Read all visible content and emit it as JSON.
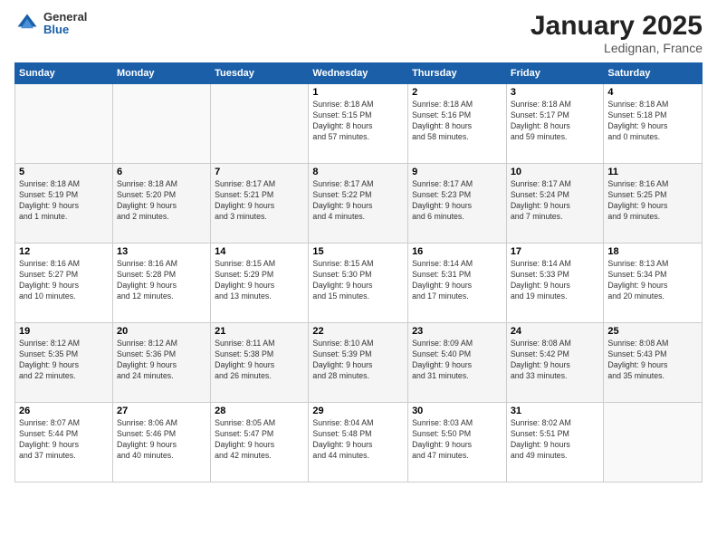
{
  "logo": {
    "general": "General",
    "blue": "Blue"
  },
  "title": "January 2025",
  "location": "Ledignan, France",
  "days_header": [
    "Sunday",
    "Monday",
    "Tuesday",
    "Wednesday",
    "Thursday",
    "Friday",
    "Saturday"
  ],
  "weeks": [
    [
      {
        "num": "",
        "info": ""
      },
      {
        "num": "",
        "info": ""
      },
      {
        "num": "",
        "info": ""
      },
      {
        "num": "1",
        "info": "Sunrise: 8:18 AM\nSunset: 5:15 PM\nDaylight: 8 hours\nand 57 minutes."
      },
      {
        "num": "2",
        "info": "Sunrise: 8:18 AM\nSunset: 5:16 PM\nDaylight: 8 hours\nand 58 minutes."
      },
      {
        "num": "3",
        "info": "Sunrise: 8:18 AM\nSunset: 5:17 PM\nDaylight: 8 hours\nand 59 minutes."
      },
      {
        "num": "4",
        "info": "Sunrise: 8:18 AM\nSunset: 5:18 PM\nDaylight: 9 hours\nand 0 minutes."
      }
    ],
    [
      {
        "num": "5",
        "info": "Sunrise: 8:18 AM\nSunset: 5:19 PM\nDaylight: 9 hours\nand 1 minute."
      },
      {
        "num": "6",
        "info": "Sunrise: 8:18 AM\nSunset: 5:20 PM\nDaylight: 9 hours\nand 2 minutes."
      },
      {
        "num": "7",
        "info": "Sunrise: 8:17 AM\nSunset: 5:21 PM\nDaylight: 9 hours\nand 3 minutes."
      },
      {
        "num": "8",
        "info": "Sunrise: 8:17 AM\nSunset: 5:22 PM\nDaylight: 9 hours\nand 4 minutes."
      },
      {
        "num": "9",
        "info": "Sunrise: 8:17 AM\nSunset: 5:23 PM\nDaylight: 9 hours\nand 6 minutes."
      },
      {
        "num": "10",
        "info": "Sunrise: 8:17 AM\nSunset: 5:24 PM\nDaylight: 9 hours\nand 7 minutes."
      },
      {
        "num": "11",
        "info": "Sunrise: 8:16 AM\nSunset: 5:25 PM\nDaylight: 9 hours\nand 9 minutes."
      }
    ],
    [
      {
        "num": "12",
        "info": "Sunrise: 8:16 AM\nSunset: 5:27 PM\nDaylight: 9 hours\nand 10 minutes."
      },
      {
        "num": "13",
        "info": "Sunrise: 8:16 AM\nSunset: 5:28 PM\nDaylight: 9 hours\nand 12 minutes."
      },
      {
        "num": "14",
        "info": "Sunrise: 8:15 AM\nSunset: 5:29 PM\nDaylight: 9 hours\nand 13 minutes."
      },
      {
        "num": "15",
        "info": "Sunrise: 8:15 AM\nSunset: 5:30 PM\nDaylight: 9 hours\nand 15 minutes."
      },
      {
        "num": "16",
        "info": "Sunrise: 8:14 AM\nSunset: 5:31 PM\nDaylight: 9 hours\nand 17 minutes."
      },
      {
        "num": "17",
        "info": "Sunrise: 8:14 AM\nSunset: 5:33 PM\nDaylight: 9 hours\nand 19 minutes."
      },
      {
        "num": "18",
        "info": "Sunrise: 8:13 AM\nSunset: 5:34 PM\nDaylight: 9 hours\nand 20 minutes."
      }
    ],
    [
      {
        "num": "19",
        "info": "Sunrise: 8:12 AM\nSunset: 5:35 PM\nDaylight: 9 hours\nand 22 minutes."
      },
      {
        "num": "20",
        "info": "Sunrise: 8:12 AM\nSunset: 5:36 PM\nDaylight: 9 hours\nand 24 minutes."
      },
      {
        "num": "21",
        "info": "Sunrise: 8:11 AM\nSunset: 5:38 PM\nDaylight: 9 hours\nand 26 minutes."
      },
      {
        "num": "22",
        "info": "Sunrise: 8:10 AM\nSunset: 5:39 PM\nDaylight: 9 hours\nand 28 minutes."
      },
      {
        "num": "23",
        "info": "Sunrise: 8:09 AM\nSunset: 5:40 PM\nDaylight: 9 hours\nand 31 minutes."
      },
      {
        "num": "24",
        "info": "Sunrise: 8:08 AM\nSunset: 5:42 PM\nDaylight: 9 hours\nand 33 minutes."
      },
      {
        "num": "25",
        "info": "Sunrise: 8:08 AM\nSunset: 5:43 PM\nDaylight: 9 hours\nand 35 minutes."
      }
    ],
    [
      {
        "num": "26",
        "info": "Sunrise: 8:07 AM\nSunset: 5:44 PM\nDaylight: 9 hours\nand 37 minutes."
      },
      {
        "num": "27",
        "info": "Sunrise: 8:06 AM\nSunset: 5:46 PM\nDaylight: 9 hours\nand 40 minutes."
      },
      {
        "num": "28",
        "info": "Sunrise: 8:05 AM\nSunset: 5:47 PM\nDaylight: 9 hours\nand 42 minutes."
      },
      {
        "num": "29",
        "info": "Sunrise: 8:04 AM\nSunset: 5:48 PM\nDaylight: 9 hours\nand 44 minutes."
      },
      {
        "num": "30",
        "info": "Sunrise: 8:03 AM\nSunset: 5:50 PM\nDaylight: 9 hours\nand 47 minutes."
      },
      {
        "num": "31",
        "info": "Sunrise: 8:02 AM\nSunset: 5:51 PM\nDaylight: 9 hours\nand 49 minutes."
      },
      {
        "num": "",
        "info": ""
      }
    ]
  ]
}
